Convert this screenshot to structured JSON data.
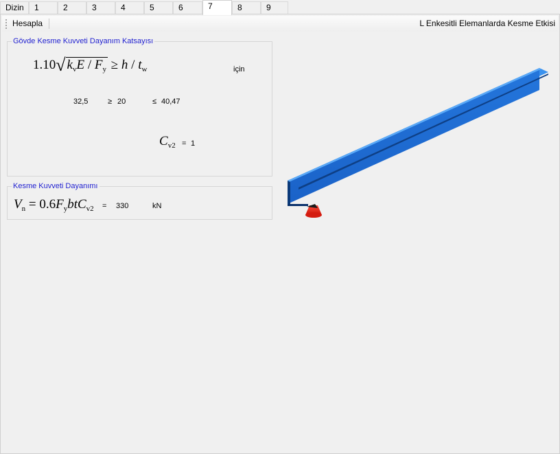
{
  "tabs": [
    {
      "label": "Dizin"
    },
    {
      "label": "1"
    },
    {
      "label": "2"
    },
    {
      "label": "3"
    },
    {
      "label": "4"
    },
    {
      "label": "5"
    },
    {
      "label": "6"
    },
    {
      "label": "7"
    },
    {
      "label": "8"
    },
    {
      "label": "9"
    }
  ],
  "active_tab": "7",
  "toolbar": {
    "calculate_label": "Hesapla",
    "title": "L Enkesitli Elemanlarda Kesme Etkisi"
  },
  "web_shear_group": {
    "title": "Gövde Kesme Kuvveti Dayanım Katsayısı",
    "formula": {
      "coef": "1.10",
      "k": "k",
      "k_sub": "v",
      "E": "E",
      "slash1": " / ",
      "F": "F",
      "F_sub": "y",
      "ge": " ≥ ",
      "h": "h",
      "slash2": " / ",
      "t": "t",
      "t_sub": "w"
    },
    "condition_label": "için",
    "value_left": "32,5",
    "ge_symbol": "≥",
    "value_mid": "20",
    "le_symbol": "≤",
    "value_right": "40,47",
    "cv2_symbol": "C",
    "cv2_sub": "v2",
    "cv2_equals": "=",
    "cv2_value": "1"
  },
  "shear_strength_group": {
    "title": "Kesme Kuvveti Dayanımı",
    "formula": {
      "V": "V",
      "V_sub": "n",
      "eq": " = 0.6",
      "F": "F",
      "F_sub": "y",
      "btC": "btC",
      "C_sub": "v2"
    },
    "equals": "=",
    "value": "330",
    "unit": "kN"
  },
  "colors": {
    "group_title": "#1f1fd0",
    "beam_top": "#2f86e8",
    "beam_side": "#1d6bd4",
    "support": "#e8261a"
  }
}
